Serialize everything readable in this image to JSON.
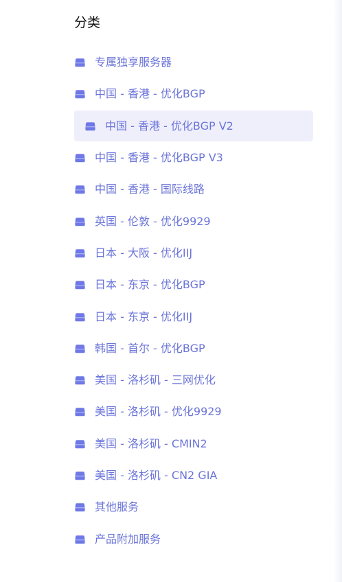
{
  "section": {
    "title": "分类"
  },
  "categories": [
    {
      "label": "专属独享服务器",
      "icon": "folder-icon",
      "active": false
    },
    {
      "label": "中国 - 香港 - 优化BGP",
      "icon": "folder-icon",
      "active": false
    },
    {
      "label": "中国 - 香港 - 优化BGP V2",
      "icon": "folder-icon",
      "active": true
    },
    {
      "label": "中国 - 香港 - 优化BGP V3",
      "icon": "folder-icon",
      "active": false
    },
    {
      "label": "中国 - 香港 - 国际线路",
      "icon": "folder-icon",
      "active": false
    },
    {
      "label": "英国 - 伦敦 - 优化9929",
      "icon": "folder-icon",
      "active": false
    },
    {
      "label": "日本 - 大阪 - 优化IIJ",
      "icon": "folder-icon",
      "active": false
    },
    {
      "label": "日本 - 东京 - 优化BGP",
      "icon": "folder-icon",
      "active": false
    },
    {
      "label": "日本 - 东京 - 优化IIJ",
      "icon": "folder-icon",
      "active": false
    },
    {
      "label": "韩国 - 首尔 - 优化BGP",
      "icon": "folder-icon",
      "active": false
    },
    {
      "label": "美国 - 洛杉矶 - 三网优化",
      "icon": "folder-icon",
      "active": false
    },
    {
      "label": "美国 - 洛杉矶 - 优化9929",
      "icon": "folder-icon",
      "active": false
    },
    {
      "label": "美国 - 洛杉矶 - CMIN2",
      "icon": "folder-icon",
      "active": false
    },
    {
      "label": "美国 - 洛杉矶 - CN2 GIA",
      "icon": "folder-icon",
      "active": false
    },
    {
      "label": "其他服务",
      "icon": "folder-icon",
      "active": false
    },
    {
      "label": "产品附加服务",
      "icon": "folder-icon",
      "active": false
    }
  ],
  "colors": {
    "accent": "#6b74d8",
    "icon": "#6f78e6",
    "active_bg": "#efeffc",
    "title": "#111111"
  }
}
